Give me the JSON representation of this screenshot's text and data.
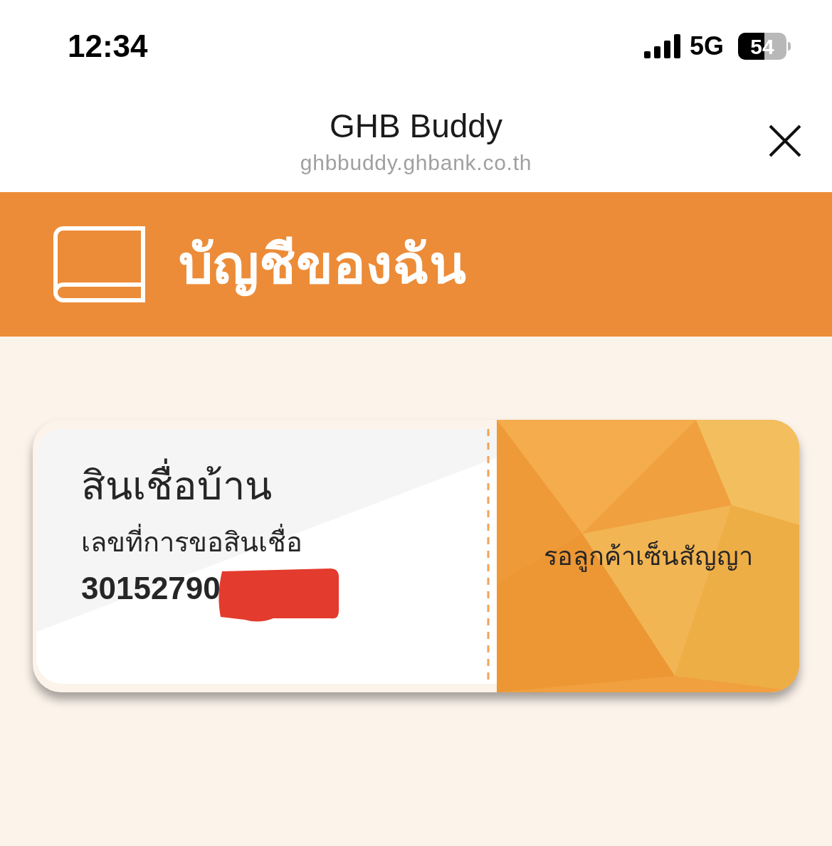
{
  "status_bar": {
    "time": "12:34",
    "network": "5G",
    "battery": "54"
  },
  "header": {
    "title": "GHB Buddy",
    "url": "ghbbuddy.ghbank.co.th"
  },
  "banner": {
    "title": "บัญชีของฉัน"
  },
  "card": {
    "title": "สินเชื่อบ้าน",
    "label": "เลขที่การขอสินเชื่อ",
    "number": "30152790",
    "redacted": true,
    "status": "รอลูกค้าเซ็นสัญญา"
  }
}
